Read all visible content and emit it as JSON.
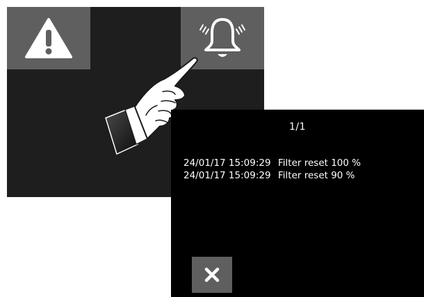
{
  "colors": {
    "tile_background": "#5f5f5f",
    "back_screen_background": "#1e1e1e",
    "front_screen_background": "#000000",
    "icon_color": "#ffffff"
  },
  "icons": {
    "warning": "warning-triangle-icon",
    "alarm": "bell-ringing-icon",
    "close": "close-icon",
    "pointer": "pointing-hand"
  },
  "alarm_log": {
    "page_indicator": "1/1",
    "entries": [
      {
        "timestamp": "24/01/17 15:09:29",
        "message": "Filter reset 100 %"
      },
      {
        "timestamp": "24/01/17 15:09:29",
        "message": "Filter reset 90 %"
      }
    ]
  }
}
